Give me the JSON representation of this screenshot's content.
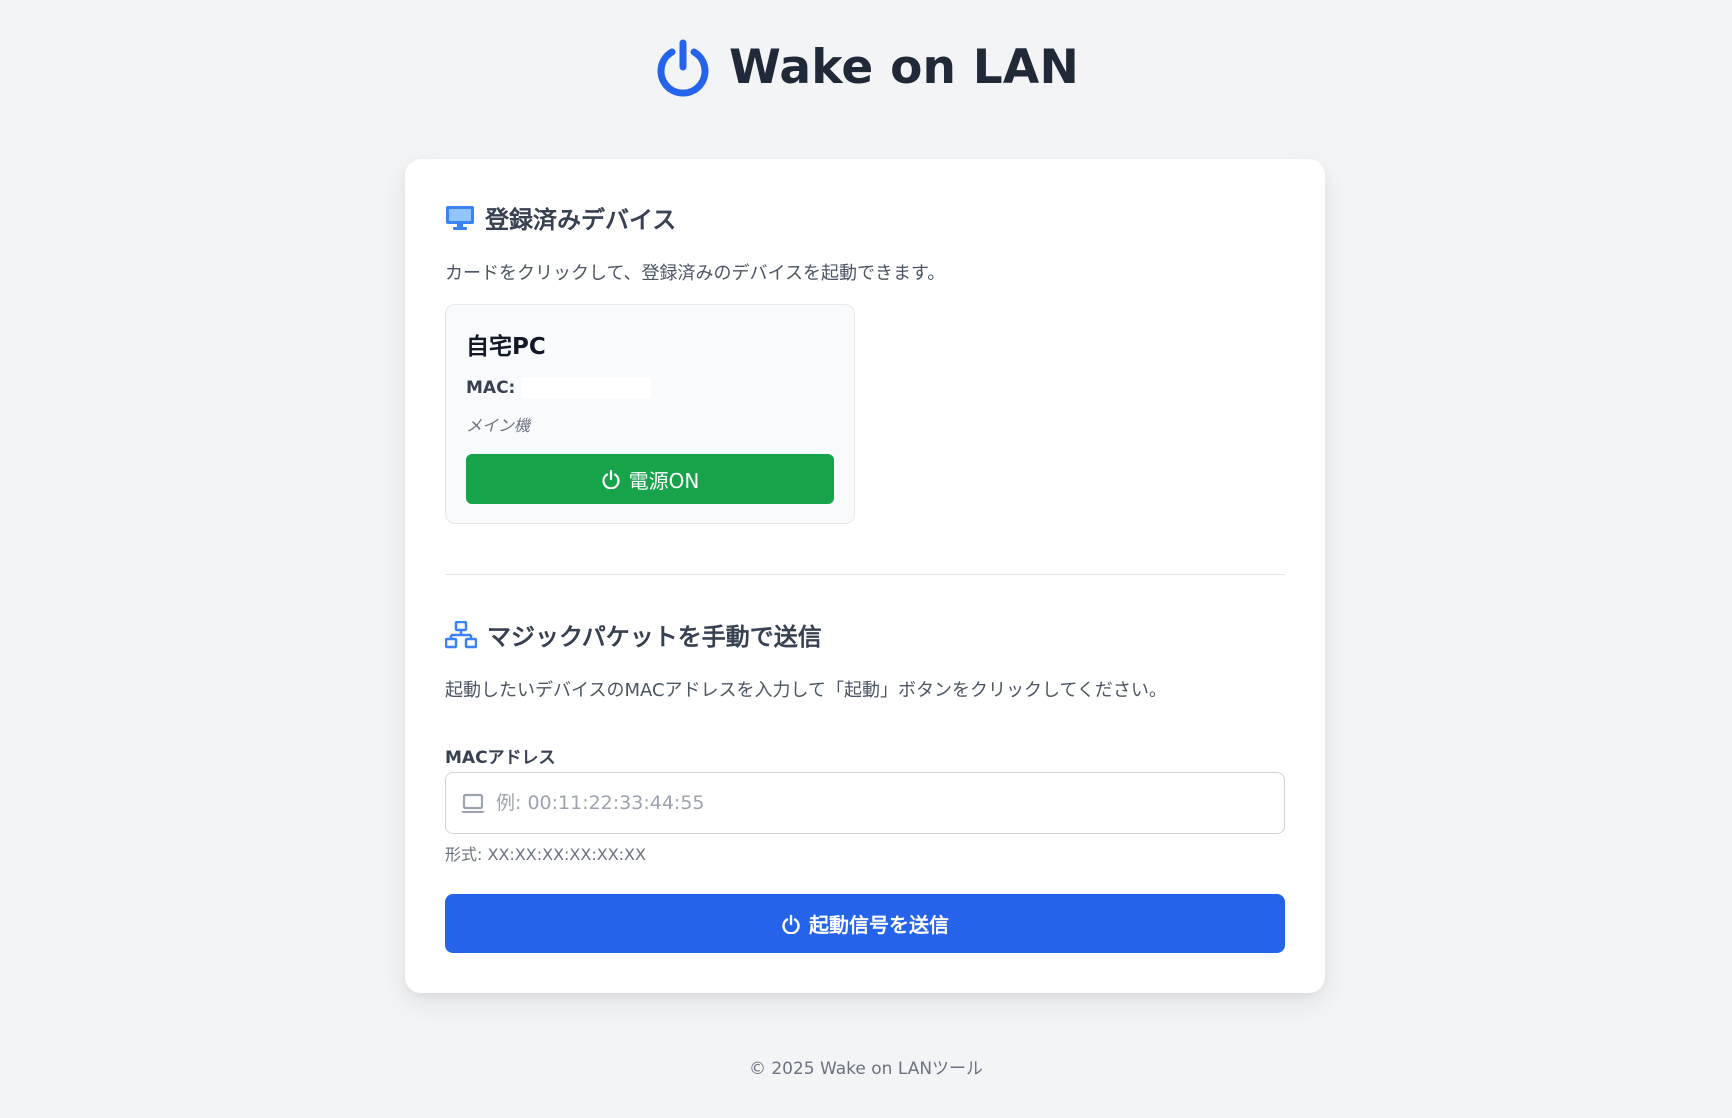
{
  "header": {
    "title": "Wake on LAN",
    "icon": "power-icon",
    "accent_color": "#2563eb"
  },
  "registered": {
    "icon": "monitor-icon",
    "title": "登録済みデバイス",
    "description": "カードをクリックして、登録済みのデバイスを起動できます。",
    "devices": [
      {
        "name": "自宅PC",
        "mac_label": "MAC:",
        "mac_value": "",
        "note": "メイン機",
        "button_icon": "power-icon",
        "button_label": "電源ON",
        "button_color": "#16a34a"
      }
    ]
  },
  "manual": {
    "icon": "network-icon",
    "title": "マジックパケットを手動で送信",
    "description": "起動したいデバイスのMACアドレスを入力して「起動」ボタンをクリックしてください。",
    "field_label": "MACアドレス",
    "input_icon": "laptop-icon",
    "input_value": "",
    "input_placeholder": "例: 00:11:22:33:44:55",
    "hint": "形式: XX:XX:XX:XX:XX:XX",
    "submit_icon": "power-icon",
    "submit_label": "起動信号を送信",
    "submit_color": "#2563eb"
  },
  "footer": {
    "text": "© 2025 Wake on LANツール"
  }
}
